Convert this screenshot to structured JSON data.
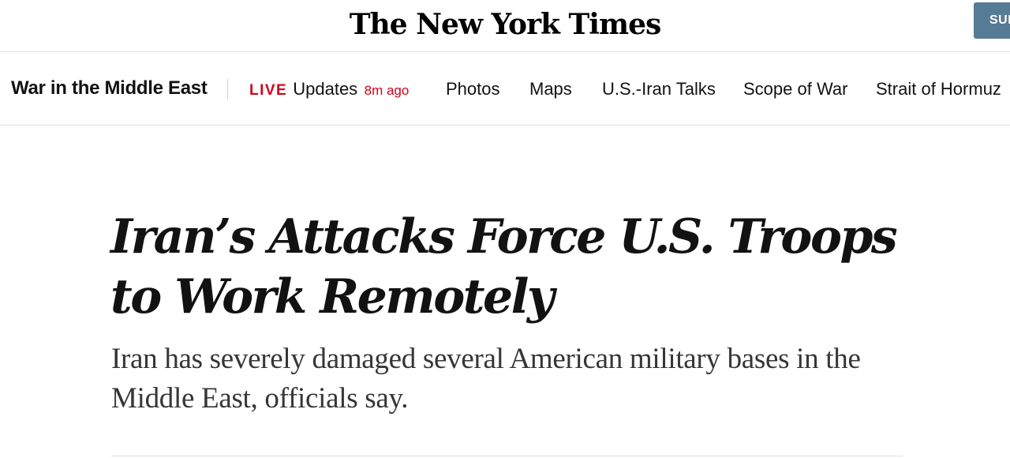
{
  "masthead": {
    "logo_text": "The New York Times",
    "subscribe_label": "SUBSCRIBE"
  },
  "section_nav": {
    "title": "War in the Middle East",
    "live": {
      "badge": "LIVE",
      "label": "Updates",
      "time": "8m ago"
    },
    "links": [
      "Photos",
      "Maps",
      "U.S.-Iran Talks",
      "Scope of War",
      "Strait of Hormuz"
    ]
  },
  "article": {
    "headline": "Iran’s Attacks Force U.S. Troops to Work Remotely",
    "summary": "Iran has severely damaged several American military bases in the Middle East, officials say."
  },
  "colors": {
    "live_red": "#d0021b",
    "subscribe_blue": "#567b95",
    "divider": "#dfdfdf"
  }
}
